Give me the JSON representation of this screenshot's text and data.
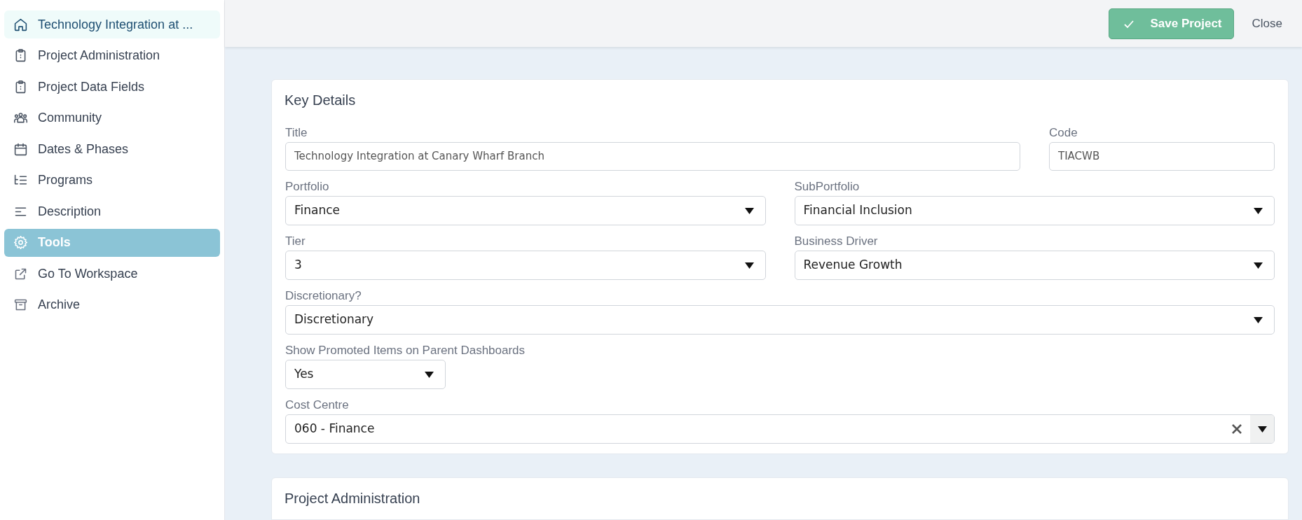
{
  "sidebar": {
    "items": [
      {
        "label": "Technology Integration at ...",
        "selected": false,
        "kind": "current"
      },
      {
        "label": "Project Administration",
        "selected": false
      },
      {
        "label": "Project Data Fields",
        "selected": false
      },
      {
        "label": "Community",
        "selected": false
      },
      {
        "label": "Dates & Phases",
        "selected": false
      },
      {
        "label": "Programs",
        "selected": false
      },
      {
        "label": "Description",
        "selected": false
      },
      {
        "label": "Tools",
        "selected": true
      },
      {
        "label": "Go To Workspace",
        "selected": false
      },
      {
        "label": "Archive",
        "selected": false
      }
    ]
  },
  "toolbar": {
    "save_button": "Save Project",
    "close_button": "Close"
  },
  "key_details": {
    "title": "Key Details",
    "rows": [
      [
        {
          "label": "Title",
          "kind": "text",
          "value": "Technology Integration at Canary Wharf Branch"
        },
        {
          "label": "Code",
          "kind": "text",
          "value": "TIACWB"
        }
      ],
      [
        {
          "label": "Portfolio",
          "kind": "select",
          "value": "Finance"
        },
        {
          "label": "SubPortfolio",
          "kind": "select",
          "value": "Financial Inclusion"
        }
      ],
      [
        {
          "label": "Tier",
          "kind": "select",
          "value": "3"
        },
        {
          "label": "Business Driver",
          "kind": "select",
          "value": "Revenue Growth"
        }
      ],
      [
        {
          "label": "Discretionary?",
          "kind": "select",
          "value": "Discretionary"
        }
      ],
      [
        {
          "label": "Show Promoted Items on Parent Dashboards",
          "kind": "select",
          "value": "Yes"
        }
      ],
      [
        {
          "label": "Cost Centre",
          "kind": "combo",
          "value": "060 - Finance"
        }
      ]
    ]
  },
  "next_section": {
    "title": "Project Administration"
  }
}
